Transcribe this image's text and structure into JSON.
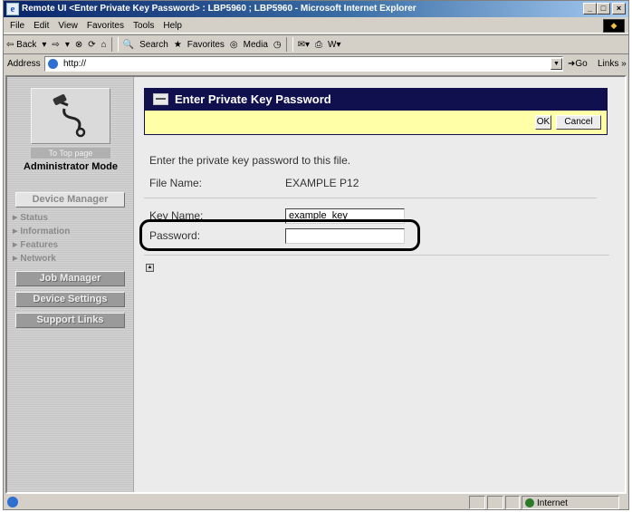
{
  "window": {
    "title": "Remote UI <Enter Private Key Password> : LBP5960 ; LBP5960 - Microsoft Internet Explorer",
    "minimize": "_",
    "maximize": "□",
    "close": "×"
  },
  "menu": [
    "File",
    "Edit",
    "View",
    "Favorites",
    "Tools",
    "Help"
  ],
  "toolbar": {
    "back": "⇦ Back",
    "forward": "⇨",
    "search": "Search",
    "favorites": "Favorites",
    "media": "Media"
  },
  "address": {
    "label": "Address",
    "url": "http://",
    "go": "Go",
    "links": "Links »"
  },
  "sidebar": {
    "top_page": "To Top page",
    "mode": "Administrator Mode",
    "device_manager": "Device Manager",
    "subitems": [
      "Status",
      "Information",
      "Features",
      "Network"
    ],
    "job_manager": "Job Manager",
    "device_settings": "Device Settings",
    "support_links": "Support Links"
  },
  "dialog": {
    "title": "Enter Private Key Password",
    "ok": "OK",
    "cancel": "Cancel",
    "intro": "Enter the private key password to this file.",
    "file_name_label": "File Name:",
    "file_name_value": "EXAMPLE P12",
    "key_name_label": "Key Name:",
    "key_name_value": "example_key",
    "password_label": "Password:",
    "password_value": ""
  },
  "status": {
    "zone": "Internet"
  }
}
